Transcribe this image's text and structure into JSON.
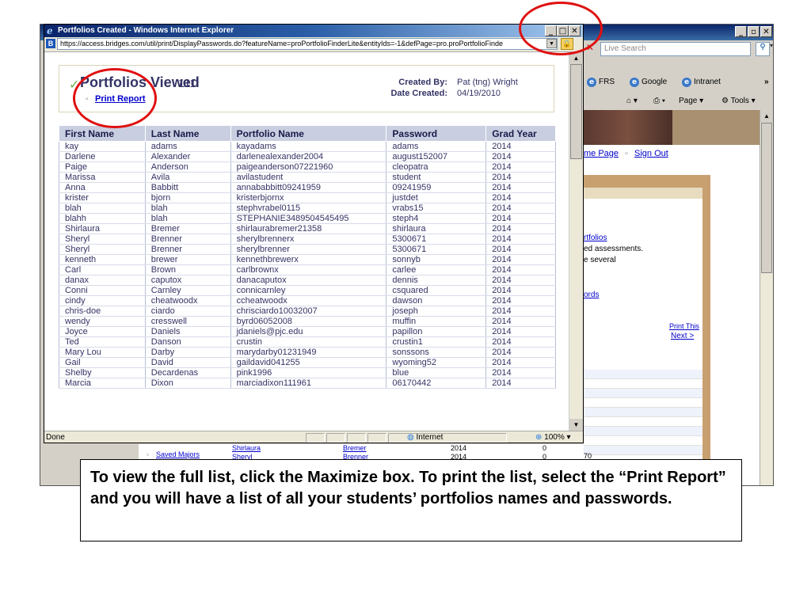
{
  "background_browser": {
    "search_placeholder": "Live Search",
    "favorites": [
      "FRS",
      "Google",
      "Intranet"
    ],
    "chevron": "»",
    "toolbar": {
      "page": "Page ▾",
      "tools": "Tools ▾"
    },
    "links": {
      "home_page": "me Page",
      "sign_out": "Sign Out"
    },
    "text_lines": [
      "rtfolios",
      "ed assessments.",
      "e several",
      "ords"
    ],
    "print_this": "Print This",
    "next": "Next >",
    "bottom_count": "70",
    "bottom_rows": [
      {
        "link": "Saved Majors",
        "name": "Shirlaura",
        "last": "Bremer",
        "year": "2014",
        "num": "0"
      },
      {
        "link": "",
        "name": "Sheryl",
        "last": "Brenner",
        "year": "2014",
        "num": "0"
      }
    ]
  },
  "popup": {
    "title": "Portfolios Created - Windows Internet Explorer",
    "url": "https://access.bridges.com/util/print/DisplayPasswords.do?featureName=proPortfolioFinderLite&entityIds=-1&defPage=pro.proPortfolioFinde",
    "status": {
      "done": "Done",
      "zone": "Internet",
      "zoom": "100%"
    },
    "header": {
      "title": "Portfolios Viewed",
      "count": "111",
      "print_link": "Print Report",
      "created_by_label": "Created By:",
      "created_by_value": "Pat (tng) Wright",
      "date_label": "Date Created:",
      "date_value": "04/19/2010"
    },
    "table": {
      "columns": [
        "First Name",
        "Last Name",
        "Portfolio Name",
        "Password",
        "Grad Year"
      ],
      "rows": [
        [
          "kay",
          "adams",
          "kayadams",
          "adams",
          "2014"
        ],
        [
          "Darlene",
          "Alexander",
          "darlenealexander2004",
          "august152007",
          "2014"
        ],
        [
          "Paige",
          "Anderson",
          "paigeanderson07221960",
          "cleopatra",
          "2014"
        ],
        [
          "Marissa",
          "Avila",
          "avilastudent",
          "student",
          "2014"
        ],
        [
          "Anna",
          "Babbitt",
          "annababbitt09241959",
          "09241959",
          "2014"
        ],
        [
          "krister",
          "bjorn",
          "kristerbjornx",
          "justdet",
          "2014"
        ],
        [
          "blah",
          "blah",
          "stephvrabel0115",
          "vrabs15",
          "2014"
        ],
        [
          "blahh",
          "blah",
          "STEPHANIE3489504545495",
          "steph4",
          "2014"
        ],
        [
          "Shirlaura",
          "Bremer",
          "shirlaurabremer21358",
          "shirlaura",
          "2014"
        ],
        [
          "Sheryl",
          "Brenner",
          "sherylbrennerx",
          "5300671",
          "2014"
        ],
        [
          "Sheryl",
          "Brenner",
          "sherylbrenner",
          "5300671",
          "2014"
        ],
        [
          "kenneth",
          "brewer",
          "kennethbrewerx",
          "sonnyb",
          "2014"
        ],
        [
          "Carl",
          "Brown",
          "carlbrownx",
          "carlee",
          "2014"
        ],
        [
          "danax",
          "caputox",
          "danacaputox",
          "dennis",
          "2014"
        ],
        [
          "Conni",
          "Carnley",
          "connicarnley",
          "csquared",
          "2014"
        ],
        [
          "cindy",
          "cheatwoodx",
          "ccheatwoodx",
          "dawson",
          "2014"
        ],
        [
          "chris-doe",
          "ciardo",
          "chrisciardo10032007",
          "joseph",
          "2014"
        ],
        [
          "wendy",
          "cresswell",
          "byrd06052008",
          "muffin",
          "2014"
        ],
        [
          "Joyce",
          "Daniels",
          "jdaniels@pjc.edu",
          "papillon",
          "2014"
        ],
        [
          "Ted",
          "Danson",
          "crustin",
          "crustin1",
          "2014"
        ],
        [
          "Mary Lou",
          "Darby",
          "marydarby01231949",
          "sonssons",
          "2014"
        ],
        [
          "Gail",
          "David",
          "gaildavid041255",
          "wyoming52",
          "2014"
        ],
        [
          "Shelby",
          "Decardenas",
          "pink1996",
          "blue",
          "2014"
        ],
        [
          "Marcia",
          "Dixon",
          "marciadixon111961",
          "06170442",
          "2014"
        ]
      ]
    }
  },
  "caption": "To view the full list, click the Maximize box.  To print the list, select the “Print Report” and you will have a list of all your students’ portfolios names and passwords.",
  "colors": {
    "annotation_ring": "#e01010",
    "table_header": "#c9cfe0",
    "link": "#0000cc"
  }
}
